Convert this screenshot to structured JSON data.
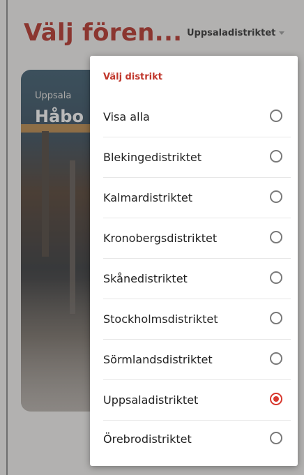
{
  "header": {
    "title": "Välj fören...",
    "district_selector": "Uppsaladistriktet"
  },
  "card": {
    "subtitle": "Uppsala",
    "title": "Håbo"
  },
  "district_menu": {
    "heading": "Välj distrikt",
    "options": [
      {
        "label": "Visa alla",
        "selected": false
      },
      {
        "label": "Blekingedistriktet",
        "selected": false
      },
      {
        "label": "Kalmardistriktet",
        "selected": false
      },
      {
        "label": "Kronobergsdistriktet",
        "selected": false
      },
      {
        "label": "Skånedistriktet",
        "selected": false
      },
      {
        "label": "Stockholmsdistriktet",
        "selected": false
      },
      {
        "label": "Sörmlandsdistriktet",
        "selected": false
      },
      {
        "label": "Uppsaladistriktet",
        "selected": true
      },
      {
        "label": "Örebrodistriktet",
        "selected": false
      }
    ]
  },
  "colors": {
    "accent": "#b52d23",
    "radio_selected": "#d8392f"
  }
}
